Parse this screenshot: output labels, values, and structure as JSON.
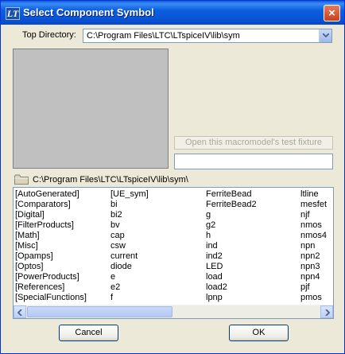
{
  "window": {
    "title": "Select Component Symbol",
    "icon": "LT",
    "close": "×"
  },
  "top_directory": {
    "label": "Top Directory:",
    "value": "C:\\Program Files\\LTC\\LTspiceIV\\lib\\sym"
  },
  "fixture_button": {
    "label": "Open this macromodel's test fixture"
  },
  "search": {
    "value": ""
  },
  "current_path": "C:\\Program Files\\LTC\\LTspiceIV\\lib\\sym\\",
  "list_columns": [
    [
      "[AutoGenerated]",
      "[Comparators]",
      "[Digital]",
      "[FilterProducts]",
      "[Math]",
      "[Misc]",
      "[Opamps]",
      "[Optos]",
      "[PowerProducts]",
      "[References]",
      "[SpecialFunctions]"
    ],
    [
      "[UE_sym]",
      "bi",
      "bi2",
      "bv",
      "cap",
      "csw",
      "current",
      "diode",
      "e",
      "e2",
      "f"
    ],
    [
      "FerriteBead",
      "FerriteBead2",
      "g",
      "g2",
      "h",
      "ind",
      "ind2",
      "LED",
      "load",
      "load2",
      "lpnp"
    ],
    [
      "ltline",
      "mesfet",
      "njf",
      "nmos",
      "nmos4",
      "npn",
      "npn2",
      "npn3",
      "npn4",
      "pjf",
      "pmos"
    ]
  ],
  "buttons": {
    "cancel": "Cancel",
    "ok": "OK"
  }
}
